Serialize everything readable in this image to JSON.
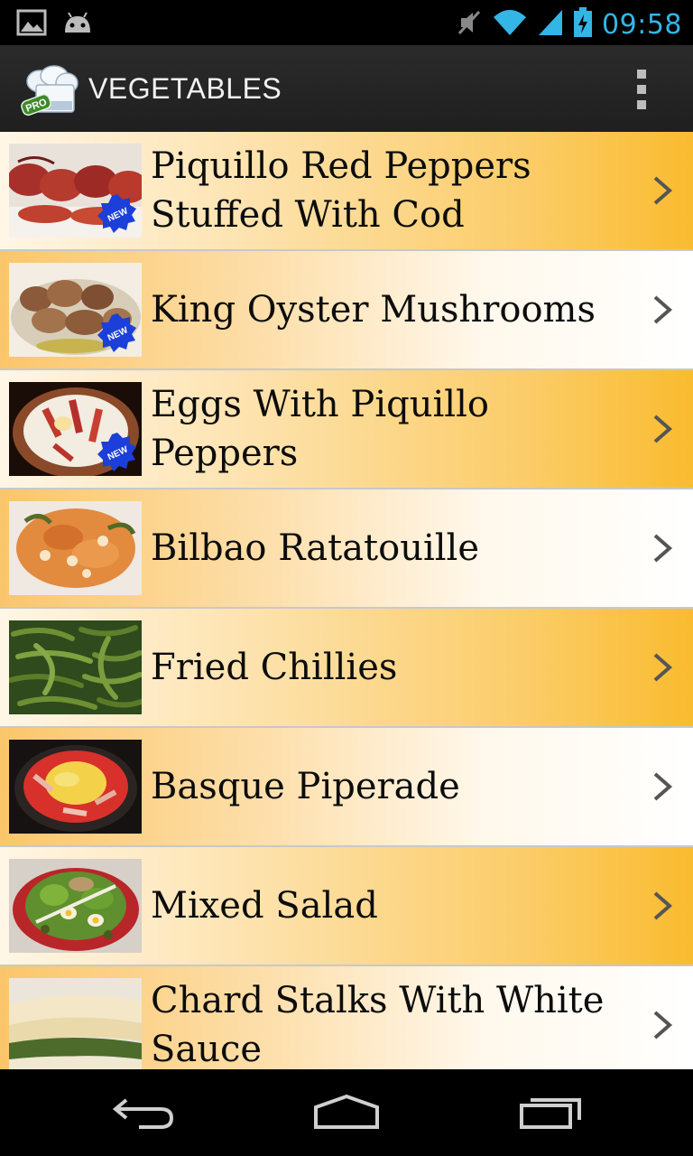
{
  "status_bar": {
    "time": "09:58",
    "left_icons": [
      "gallery-icon",
      "android-icon"
    ],
    "right_icons": [
      "mute-icon",
      "wifi-icon",
      "signal-icon",
      "battery-charging-icon"
    ],
    "accent_color": "#33b5e5"
  },
  "action_bar": {
    "title": "VEGETABLES",
    "app_icon": "chef-hat-pro-icon",
    "app_icon_badge": "PRO",
    "menu_icon": "overflow-menu-icon"
  },
  "recipes": [
    {
      "title": "Piquillo Red Peppers Stuffed With Cod",
      "new": true,
      "new_badge": "NEW",
      "thumb": "stuffed-peppers-photo"
    },
    {
      "title": "King Oyster Mushrooms",
      "new": true,
      "new_badge": "NEW",
      "thumb": "mushrooms-photo"
    },
    {
      "title": "Eggs With Piquillo Peppers",
      "new": true,
      "new_badge": "NEW",
      "thumb": "eggs-peppers-photo"
    },
    {
      "title": "Bilbao Ratatouille",
      "new": false,
      "thumb": "ratatouille-photo"
    },
    {
      "title": "Fried Chillies",
      "new": false,
      "thumb": "fried-chillies-photo"
    },
    {
      "title": "Basque Piperade",
      "new": false,
      "thumb": "piperade-photo"
    },
    {
      "title": "Mixed Salad",
      "new": false,
      "thumb": "mixed-salad-photo"
    },
    {
      "title": "Chard Stalks With White Sauce",
      "new": false,
      "thumb": "chard-stalks-photo"
    }
  ],
  "nav_bar": {
    "buttons": [
      "back-icon",
      "home-icon",
      "recent-apps-icon"
    ]
  }
}
